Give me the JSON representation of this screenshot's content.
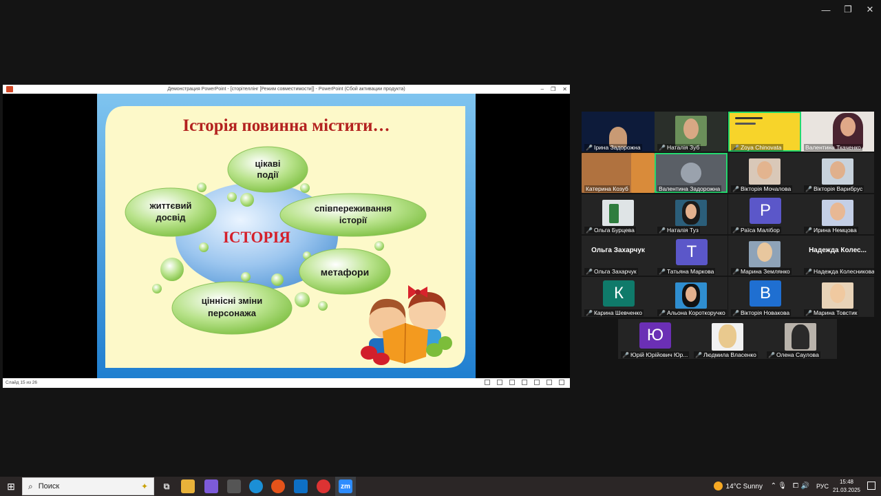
{
  "window_controls": {
    "minimize": "—",
    "restore": "❐",
    "close": "✕"
  },
  "ppt": {
    "title": "Демонстрация PowerPoint - [сторітеллінг [Режим совместимости]] - PowerPoint (Сбой активации продукта)",
    "status": "Слайд 15 из 26",
    "controls": {
      "minimize": "–",
      "restore": "❐",
      "close": "✕"
    }
  },
  "slide": {
    "heading": "Історія повинна містити…",
    "center": "ІСТОРІЯ",
    "b1_l1": "цікаві",
    "b1_l2": "події",
    "b2_l1": "життєвий",
    "b2_l2": "досвід",
    "b3_l1": "співпереживання",
    "b3_l2": "історії",
    "b4": "метафори",
    "b5_l1": "ціннісні зміни",
    "b5_l2": "персонажа"
  },
  "participants": [
    {
      "name": "Ірина Задорожна",
      "muted": true
    },
    {
      "name": "Наталія Зуб",
      "muted": true
    },
    {
      "name": "Zoya Chinovata",
      "muted": true
    },
    {
      "name": "Валентина Ткаченко",
      "muted": false
    },
    {
      "name": "Катерина Козуб",
      "muted": false
    },
    {
      "name": "Валентина Задорожна",
      "muted": false
    },
    {
      "name": "Вікторія Мочалова",
      "muted": true
    },
    {
      "name": "Вікторія Варибрус",
      "muted": true
    },
    {
      "name": "Ольга Бурцева",
      "muted": true
    },
    {
      "name": "Наталія Туз",
      "muted": true
    },
    {
      "name": "Раїса Малібор",
      "muted": true,
      "letter": "Р"
    },
    {
      "name": "Ирина Немцова",
      "muted": true
    },
    {
      "name": "Ольга Захарчук",
      "muted": true,
      "display": "Ольга Захарчук"
    },
    {
      "name": "Татьяна Маркова",
      "muted": true,
      "letter": "Т"
    },
    {
      "name": "Марина Землянко",
      "muted": true
    },
    {
      "name": "Надежда Колесникова",
      "muted": true,
      "display": "Надежда  Колес..."
    },
    {
      "name": "Карина Шевченко",
      "muted": true,
      "letter": "К"
    },
    {
      "name": "Альона Короткоручко",
      "muted": true
    },
    {
      "name": "Вікторія Новакова",
      "muted": true,
      "letter": "В"
    },
    {
      "name": "Марина Товстик",
      "muted": true
    },
    {
      "name": "Юрій Юрійович Юр...",
      "muted": true,
      "letter": "Ю"
    },
    {
      "name": "Людмила Власенко",
      "muted": true
    },
    {
      "name": "Олена Саулова",
      "muted": true
    }
  ],
  "taskbar": {
    "search_placeholder": "Поиск",
    "weather": "14°C  Sunny",
    "lang": "РУС",
    "time": "15:48",
    "date": "21.03.2025",
    "zoom_label": "zm"
  }
}
